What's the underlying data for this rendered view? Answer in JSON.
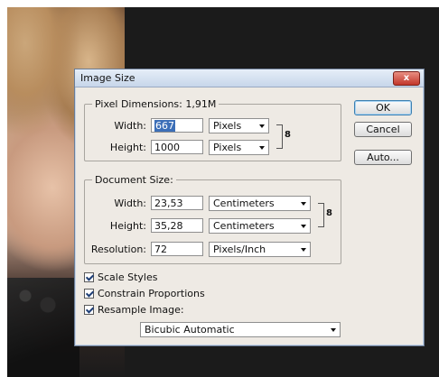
{
  "dialog": {
    "title": "Image Size",
    "close_label": "x"
  },
  "pixel_dimensions": {
    "legend": "Pixel Dimensions:  1,91M",
    "width_label": "Width:",
    "width_value": "667",
    "width_unit": "Pixels",
    "height_label": "Height:",
    "height_value": "1000",
    "height_unit": "Pixels"
  },
  "document_size": {
    "legend": "Document Size:",
    "width_label": "Width:",
    "width_value": "23,53",
    "width_unit": "Centimeters",
    "height_label": "Height:",
    "height_value": "35,28",
    "height_unit": "Centimeters",
    "resolution_label": "Resolution:",
    "resolution_value": "72",
    "resolution_unit": "Pixels/Inch"
  },
  "buttons": {
    "ok": "OK",
    "cancel": "Cancel",
    "auto": "Auto..."
  },
  "options": {
    "scale_styles": "Scale Styles",
    "constrain_proportions": "Constrain Proportions",
    "resample_image": "Resample Image:",
    "resample_method": "Bicubic Automatic"
  },
  "icons": {
    "link": "chain-link-icon"
  }
}
